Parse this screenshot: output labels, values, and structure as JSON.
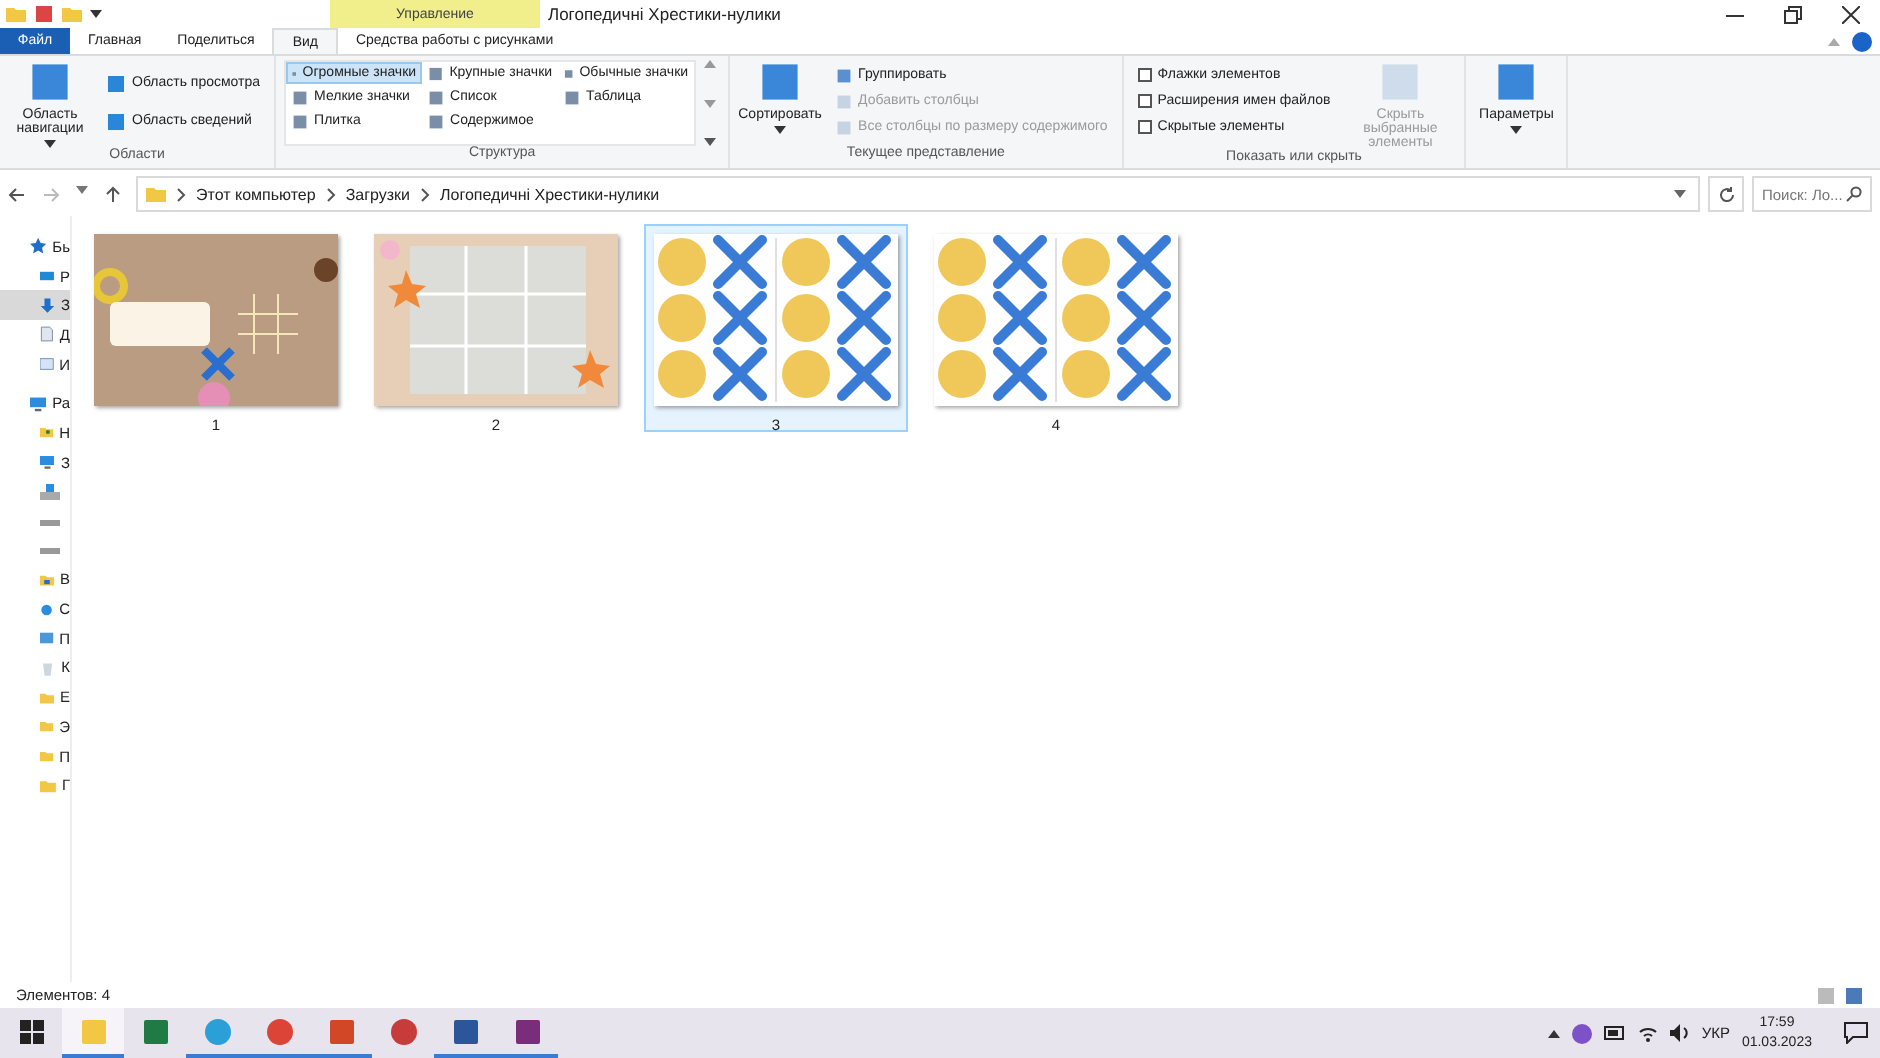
{
  "window": {
    "title": "Логопедичні Хрестики-нулики",
    "context_tab_group": "Управление"
  },
  "ribbon_tabs": [
    {
      "label": "Файл",
      "kind": "file",
      "selected": false
    },
    {
      "label": "Главная",
      "kind": "tab",
      "selected": false
    },
    {
      "label": "Поделиться",
      "kind": "tab",
      "selected": false
    },
    {
      "label": "Вид",
      "kind": "tab",
      "selected": true
    },
    {
      "label": "Средства работы с рисунками",
      "kind": "tab",
      "selected": false
    }
  ],
  "ribbon_groups": [
    {
      "kind": "panes",
      "label": "Области",
      "big": {
        "label": "Область навигации",
        "dropdown": true
      },
      "items": [
        {
          "label": "Область просмотра"
        },
        {
          "label": "Область сведений"
        }
      ]
    },
    {
      "kind": "layout",
      "label": "Структура",
      "items": [
        {
          "label": "Огромные значки",
          "selected": true
        },
        {
          "label": "Мелкие значки",
          "selected": false
        },
        {
          "label": "Плитка",
          "selected": false
        },
        {
          "label": "Крупные значки",
          "selected": false
        },
        {
          "label": "Список",
          "selected": false
        },
        {
          "label": "Содержимое",
          "selected": false
        },
        {
          "label": "Обычные значки",
          "selected": false
        },
        {
          "label": "Таблица",
          "selected": false
        }
      ]
    },
    {
      "kind": "view",
      "label": "Текущее представление",
      "big": {
        "label": "Сортировать",
        "dropdown": true
      },
      "items": [
        {
          "label": "Группировать",
          "disabled": false
        },
        {
          "label": "Добавить столбцы",
          "disabled": true
        },
        {
          "label": "Все столбцы по размеру содержимого",
          "disabled": true
        }
      ]
    },
    {
      "kind": "showhide",
      "label": "Показать или скрыть",
      "checks": [
        {
          "label": "Флажки элементов",
          "checked": false
        },
        {
          "label": "Расширения имен файлов",
          "checked": false
        },
        {
          "label": "Скрытые элементы",
          "checked": false
        }
      ],
      "big": {
        "label": "Скрыть выбранные элементы",
        "disabled": true
      }
    },
    {
      "kind": "options",
      "big": {
        "label": "Параметры",
        "dropdown": true
      }
    }
  ],
  "address": {
    "path": [
      "Этот компьютер",
      "Загрузки",
      "Логопедичні Хрестики-нулики"
    ],
    "search_placeholder": "Поиск: Ло..."
  },
  "sidebar": {
    "items": [
      {
        "label": "Бь",
        "kind": "star",
        "selected": false
      },
      {
        "label": "Р",
        "kind": "desktop",
        "selected": false
      },
      {
        "label": "З",
        "kind": "download",
        "selected": true
      },
      {
        "label": "Д",
        "kind": "doc",
        "selected": false
      },
      {
        "label": "И",
        "kind": "image",
        "selected": false
      },
      {
        "label": "Ра",
        "kind": "pc",
        "selected": false
      },
      {
        "label": "Н",
        "kind": "user",
        "selected": false
      },
      {
        "label": "З",
        "kind": "pc",
        "selected": false
      },
      {
        "kind": "win",
        "selected": false
      },
      {
        "kind": "drive",
        "selected": false
      },
      {
        "kind": "drive",
        "selected": false
      },
      {
        "label": "В",
        "kind": "libfolder",
        "selected": false
      },
      {
        "label": "С",
        "kind": "network",
        "selected": false
      },
      {
        "label": "П",
        "kind": "panel",
        "selected": false
      },
      {
        "label": "К",
        "kind": "bin",
        "selected": false
      },
      {
        "label": "Е",
        "kind": "folder",
        "selected": false
      },
      {
        "label": "Э",
        "kind": "folder",
        "selected": false
      },
      {
        "label": "П",
        "kind": "folder",
        "selected": false
      },
      {
        "label": "Г",
        "kind": "folder",
        "selected": false
      }
    ]
  },
  "files": [
    {
      "name": "1",
      "kind": "title",
      "selected": false
    },
    {
      "name": "2",
      "kind": "grid",
      "selected": false
    },
    {
      "name": "3",
      "kind": "cards",
      "selected": true
    },
    {
      "name": "4",
      "kind": "cards",
      "selected": false
    }
  ],
  "status_bar": {
    "count": "Элементов: 4"
  },
  "taskbar": {
    "apps": [
      {
        "kind": "explorer",
        "active": true
      },
      {
        "kind": "excel",
        "active": false
      },
      {
        "kind": "telegram",
        "active": true
      },
      {
        "kind": "chrome",
        "active": true
      },
      {
        "kind": "powerpoint",
        "active": true
      },
      {
        "kind": "reader",
        "active": false
      },
      {
        "kind": "word",
        "active": true
      },
      {
        "kind": "winrar",
        "active": true
      }
    ],
    "language": "УКР",
    "time": "17:59",
    "date": "01.03.2023"
  }
}
